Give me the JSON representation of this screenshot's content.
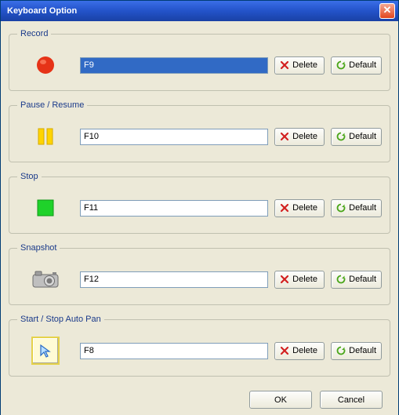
{
  "window": {
    "title": "Keyboard Option"
  },
  "groups": {
    "record": {
      "legend": "Record",
      "key": "F9",
      "selected": true
    },
    "pause": {
      "legend": "Pause / Resume",
      "key": "F10",
      "selected": false
    },
    "stop": {
      "legend": "Stop",
      "key": "F11",
      "selected": false
    },
    "snapshot": {
      "legend": "Snapshot",
      "key": "F12",
      "selected": false
    },
    "autopan": {
      "legend": "Start / Stop Auto Pan",
      "key": "F8",
      "selected": false
    }
  },
  "buttons": {
    "delete": "Delete",
    "default": "Default",
    "ok": "OK",
    "cancel": "Cancel"
  },
  "colors": {
    "record_red": "#e63317",
    "pause_yellow": "#ffd400",
    "stop_green": "#1fd22a",
    "delete_x": "#d22020",
    "refresh_grn": "#4aa61a"
  }
}
